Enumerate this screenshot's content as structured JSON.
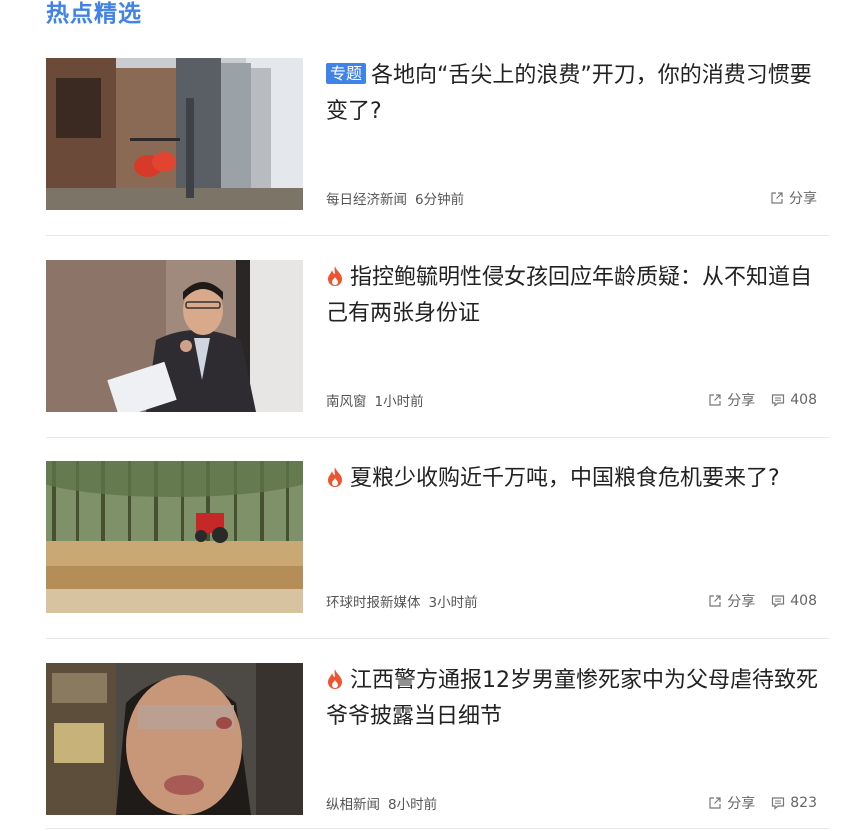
{
  "section": {
    "title": "热点精选"
  },
  "articles": [
    {
      "badge": "专题",
      "hot": false,
      "title": "各地向“舌尖上的浪费”开刀，你的消费习惯要变了?",
      "source": "每日经济新闻",
      "time": "6分钟前",
      "share_label": "分享",
      "comments": null
    },
    {
      "badge": null,
      "hot": true,
      "title": "指控鲍毓明性侵女孩回应年龄质疑：从不知道自己有两张身份证",
      "source": "南风窗",
      "time": "1小时前",
      "share_label": "分享",
      "comments": "408"
    },
    {
      "badge": null,
      "hot": true,
      "title": "夏粮少收购近千万吨，中国粮食危机要来了?",
      "source": "环球时报新媒体",
      "time": "3小时前",
      "share_label": "分享",
      "comments": "408"
    },
    {
      "badge": null,
      "hot": true,
      "title": "江西警方通报12岁男童惨死家中为父母虐待致死 爷爷披露当日细节",
      "source": "纵相新闻",
      "time": "8小时前",
      "share_label": "分享",
      "comments": "823"
    }
  ],
  "icons": {
    "hot": "fire-icon",
    "share": "share-icon",
    "comment": "comment-icon"
  },
  "colors": {
    "accent": "#3f82e8",
    "hot": "#f0542e"
  }
}
